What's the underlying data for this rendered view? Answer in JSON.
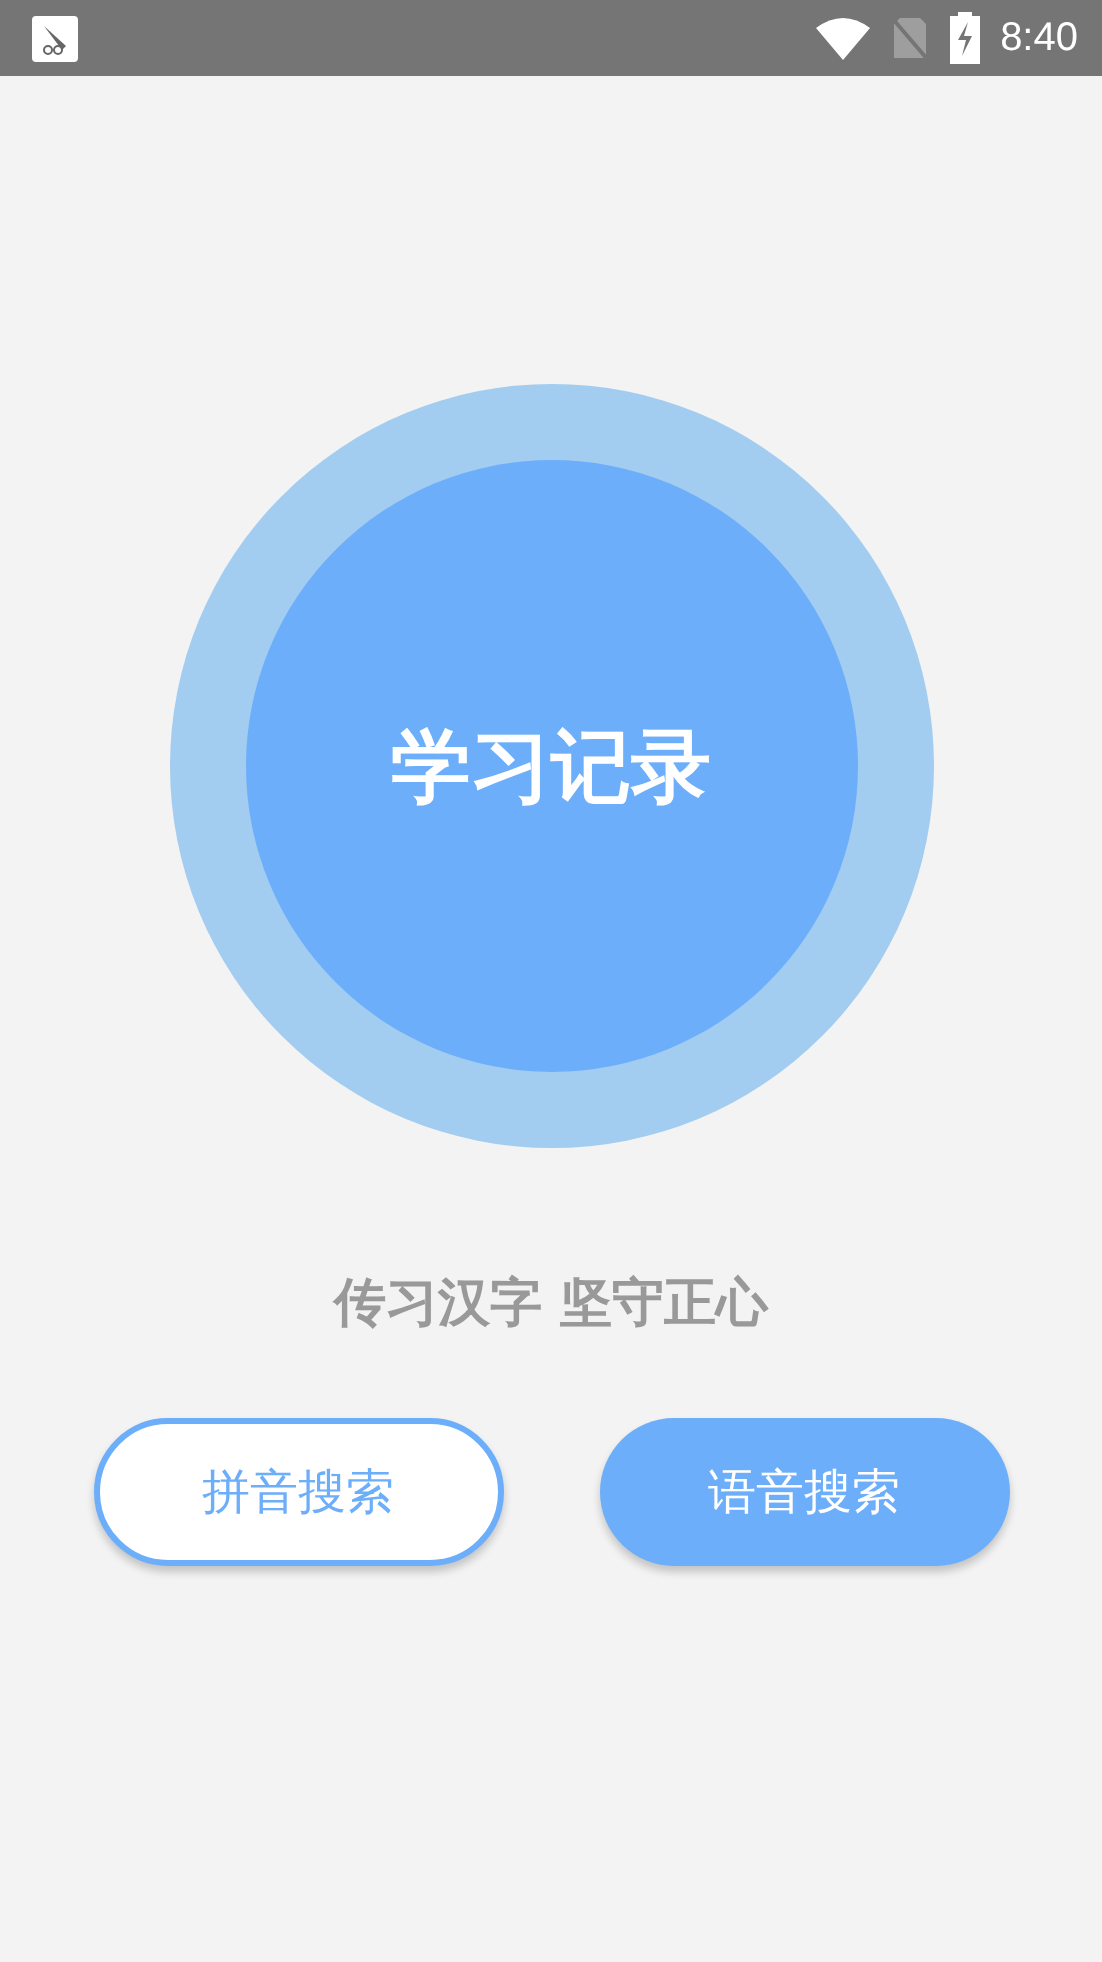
{
  "status_bar": {
    "time": "8:40"
  },
  "record_button": {
    "label": "学习记录"
  },
  "slogan": "传习汉字 坚守正心",
  "buttons": [
    {
      "label": "拼音搜索",
      "kind": "outline"
    },
    {
      "label": "语音搜索",
      "kind": "filled"
    }
  ]
}
